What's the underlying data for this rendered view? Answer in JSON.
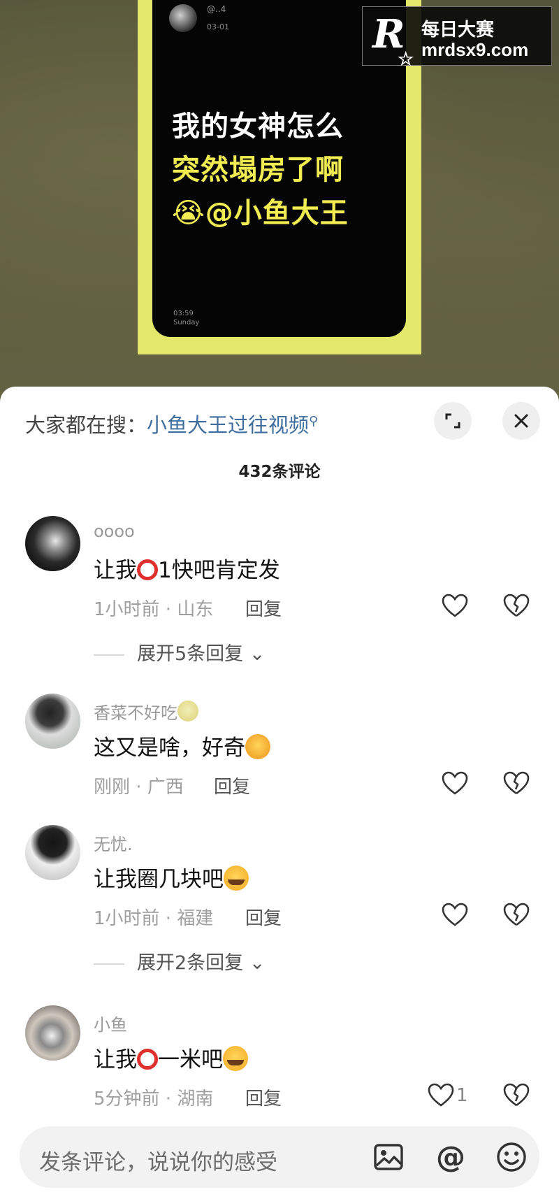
{
  "video": {
    "post_user": "@..4",
    "post_date": "03-01",
    "headline_line1": "我的女神怎么",
    "headline_line2": "突然塌房了啊",
    "headline_line3": "😭@小鱼大王",
    "time": "03:59",
    "weekday": "Sunday"
  },
  "watermark": {
    "logo": "R",
    "line1": "每日大赛",
    "line2": "mrdsx9.com"
  },
  "sheet": {
    "search_prefix": "大家都在搜：",
    "search_link": "小鱼大王过往视频",
    "comment_count": "432条评论"
  },
  "comments": [
    {
      "name": "oooo",
      "text_before": "让我",
      "text_after": "1快吧肯定发",
      "meta": "1小时前 · 山东",
      "reply": "回复",
      "expand": "展开5条回复"
    },
    {
      "name": "香菜不好吃",
      "text_before": "这又是啥，好奇",
      "text_after": "",
      "meta": "刚刚 · 广西",
      "reply": "回复",
      "expand": ""
    },
    {
      "name": "无忧.",
      "text_before": "让我圈几块吧",
      "text_after": "",
      "meta": "1小时前 · 福建",
      "reply": "回复",
      "expand": "展开2条回复"
    },
    {
      "name": "小鱼",
      "text_before": "让我",
      "text_after": "一米吧",
      "meta": "5分钟前 · 湖南",
      "reply": "回复",
      "like_count": "1",
      "expand": ""
    }
  ],
  "input": {
    "placeholder": "发条评论，说说你的感受"
  },
  "colors": {
    "link": "#3e6d9e",
    "headline_yellow": "#f0ec52",
    "frame_yellow": "#e3e86b"
  }
}
